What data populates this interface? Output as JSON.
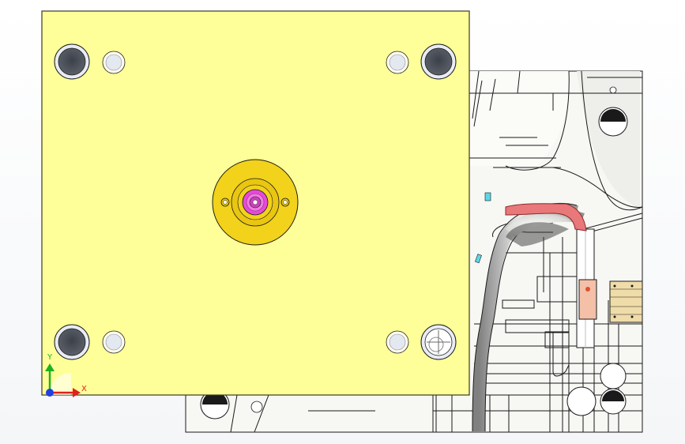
{
  "viewport": {
    "name": "CAD 3D viewport",
    "background": "#ffffff"
  },
  "colors": {
    "plate": "#ffff99",
    "plate_edge": "#3a3a2a",
    "ring": "#f2d21a",
    "ring_inner": "#e2c010",
    "sprue": "#e64ad8",
    "sprue_core": "#b8289e",
    "hole_dark": "#4a4e58",
    "hole_ring": "#e8ecf4",
    "mold_body": "#f7f7f4",
    "mold_lines": "#1a1a1a",
    "runner_highlight": "#e8787a",
    "insert_peach": "#f4c0a8",
    "gate_cyan": "#5ad8e8",
    "block_tan": "#f0dca8",
    "axis_x": "#e02020",
    "axis_y": "#20b020",
    "axis_z": "#2040e0"
  },
  "triad": {
    "x_label": "X",
    "y_label": "Y"
  }
}
